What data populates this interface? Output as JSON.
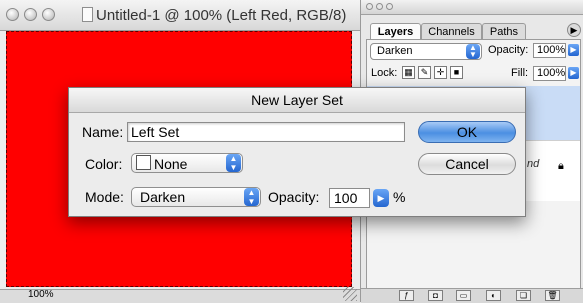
{
  "document": {
    "title": "Untitled-1 @ 100% (Left Red, RGB/8)",
    "zoom": "100%",
    "canvas_color": "#ff0000"
  },
  "layers_palette": {
    "tabs": [
      "Layers",
      "Channels",
      "Paths"
    ],
    "blend_mode": "Darken",
    "opacity_label": "Opacity:",
    "opacity_value": "100%",
    "lock_label": "Lock:",
    "fill_label": "Fill:",
    "fill_value": "100%",
    "layer_name_tail": "nd"
  },
  "dialog": {
    "title": "New Layer Set",
    "name_label": "Name:",
    "name_value": "Left Set",
    "color_label": "Color:",
    "color_value": "None",
    "mode_label": "Mode:",
    "mode_value": "Darken",
    "opacity_label": "Opacity:",
    "opacity_value": "100",
    "percent": "%",
    "ok_label": "OK",
    "cancel_label": "Cancel"
  },
  "colors": {
    "accent": "#4b8fe2",
    "selection": "#c9dcf6"
  }
}
